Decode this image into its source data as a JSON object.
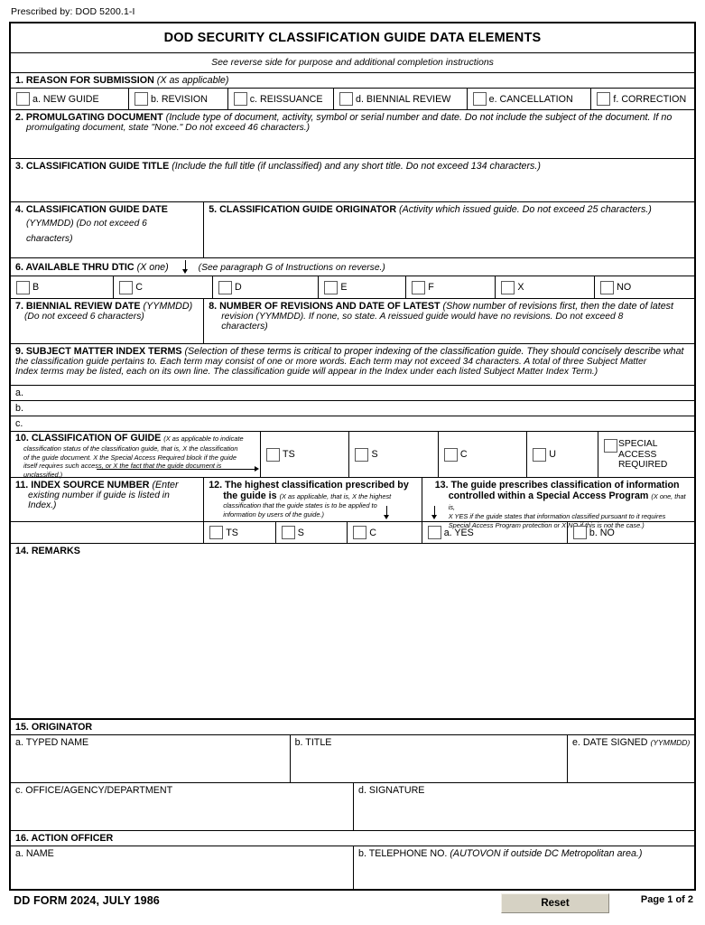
{
  "header": {
    "prescribed_by": "Prescribed by: DOD 5200.1-I",
    "title": "DOD SECURITY CLASSIFICATION GUIDE DATA ELEMENTS",
    "subtitle": "See reverse side for purpose and additional completion instructions"
  },
  "s1": {
    "number": "1. ",
    "label": "REASON FOR SUBMISSION ",
    "hint": "(X as applicable)",
    "options": [
      {
        "label": "a. NEW GUIDE"
      },
      {
        "label": "b. REVISION"
      },
      {
        "label": "c. REISSUANCE"
      },
      {
        "label": "d. BIENNIAL REVIEW"
      },
      {
        "label": "e. CANCELLATION"
      },
      {
        "label": "f. CORRECTION"
      }
    ]
  },
  "s2": {
    "number": "2. ",
    "label": "PROMULGATING DOCUMENT ",
    "hint_line1": "(Include type of document, activity, symbol or serial number and date.  Do not include the subject of the document.  If no",
    "hint_line2": "promulgating document, state \"None.\"  Do not exceed 46 characters.)",
    "value": ""
  },
  "s3": {
    "number": "3. ",
    "label": "CLASSIFICATION GUIDE TITLE ",
    "hint": "(Include the full title (if unclassified) and any short title.  Do not exceed 134 characters.)",
    "value": ""
  },
  "s4": {
    "number": "4. ",
    "label": "CLASSIFICATION GUIDE DATE",
    "hint_line1": "(YYMMDD) (Do not exceed 6",
    "hint_line2": "characters)",
    "value": ""
  },
  "s5": {
    "number": "5. ",
    "label": "CLASSIFICATION GUIDE ORIGINATOR ",
    "hint": "(Activity which issued guide.  Do not exceed 25 characters.)",
    "value": ""
  },
  "s6": {
    "number": "6. ",
    "label": "AVAILABLE THRU DTIC ",
    "hint": "(X one)",
    "note": "(See paragraph G of Instructions on reverse.)",
    "options": [
      {
        "label": "B"
      },
      {
        "label": "C"
      },
      {
        "label": "D"
      },
      {
        "label": "E"
      },
      {
        "label": "F"
      },
      {
        "label": "X"
      },
      {
        "label": "NO"
      }
    ]
  },
  "s7": {
    "number": "7. ",
    "label": "BIENNIAL REVIEW DATE  ",
    "hint": "(YYMMDD)",
    "hint_line2": "(Do not exceed 6 characters)",
    "value": ""
  },
  "s8": {
    "number": "8. ",
    "label": "NUMBER OF REVISIONS AND DATE OF LATEST ",
    "hint_line1": "(Show number of revisions first, then the date of latest",
    "hint_line2": "revision (YYMMDD).  If none, so state.  A reissued guide would have no revisions.  Do not exceed 8",
    "hint_line3": "characters)",
    "value": ""
  },
  "s9": {
    "number": "9. ",
    "label": "SUBJECT MATTER INDEX TERMS ",
    "hint_line1": "(Selection of these terms is critical to proper indexing of the classification guide.  They should concisely describe what",
    "hint_line2": "the classification guide pertains to.  Each term may consist of one or more words.  Each term may not exceed 34 characters.  A total of three Subject Matter",
    "hint_line3": "Index terms may be listed, each on its own line.  The classification guide will appear in the Index under each listed Subject Matter Index Term.)",
    "terms": [
      {
        "label": "a.",
        "value": ""
      },
      {
        "label": "b.",
        "value": ""
      },
      {
        "label": "c.",
        "value": ""
      }
    ]
  },
  "s10": {
    "number": "10. ",
    "label": "CLASSIFICATION OF GUIDE  ",
    "hint_line1": "(X as applicable to indicate",
    "hint_line2": "classification status of the classification guide, that is, X the classification",
    "hint_line3": "of the guide document.  X the Special Access Required block if the guide",
    "hint_line4": "itself requires such access, or X the fact that the guide document is",
    "hint_line5": "unclassified.)",
    "options": [
      {
        "label": "TS"
      },
      {
        "label": "S"
      },
      {
        "label": "C"
      },
      {
        "label": "U"
      },
      {
        "label": "SPECIAL ACCESS",
        "label2": "REQUIRED"
      }
    ]
  },
  "s11": {
    "number": "11. ",
    "label": "INDEX SOURCE NUMBER ",
    "hint_line1": "(Enter",
    "hint_line2": "existing number if guide is listed in",
    "hint_line3": "Index.)",
    "value": ""
  },
  "s12": {
    "number": "12. ",
    "label_line1": "The highest classification prescribed by",
    "label_line2": "the guide is ",
    "hint_line1": "(X as applicable, that is, X the highest",
    "hint_line2": "classification that the guide states is to be applied to",
    "hint_line3": "information by users of the guide.)",
    "options": [
      {
        "label": "TS"
      },
      {
        "label": "S"
      },
      {
        "label": "C"
      }
    ]
  },
  "s13": {
    "number": "13. ",
    "label_line1": "The guide prescribes classification of information",
    "label_line2": "controlled within a Special Access Program ",
    "hint_line1": "(X one, that is,",
    "hint_line2": "X YES if the guide states that information classified pursuant to it requires",
    "hint_line3": "Special Access Program protection or X NO if this is not the case.)",
    "options": [
      {
        "label": "a. YES"
      },
      {
        "label": "b. NO"
      }
    ]
  },
  "s14": {
    "number": "14. ",
    "label": "REMARKS",
    "value": ""
  },
  "s15": {
    "number": "15. ",
    "label": "ORIGINATOR",
    "typed_name_label": "a. TYPED NAME",
    "typed_name_value": "",
    "title_label": "b. TITLE",
    "title_value": "",
    "date_signed_label": "e. DATE SIGNED ",
    "date_signed_hint": "(YYMMDD)",
    "date_signed_value": "",
    "office_label": "c. OFFICE/AGENCY/DEPARTMENT",
    "office_value": "",
    "signature_label": "d. SIGNATURE",
    "signature_value": ""
  },
  "s16": {
    "number": "16. ",
    "label": "ACTION OFFICER",
    "name_label": "a. NAME",
    "name_value": "",
    "phone_label": "b. TELEPHONE NO.  ",
    "phone_hint": "(AUTOVON if outside DC Metropolitan area.)",
    "phone_value": ""
  },
  "footer": {
    "form_id": "DD FORM 2024, JULY 1986",
    "reset_label": "Reset",
    "page_number": "Page 1 of 2"
  }
}
